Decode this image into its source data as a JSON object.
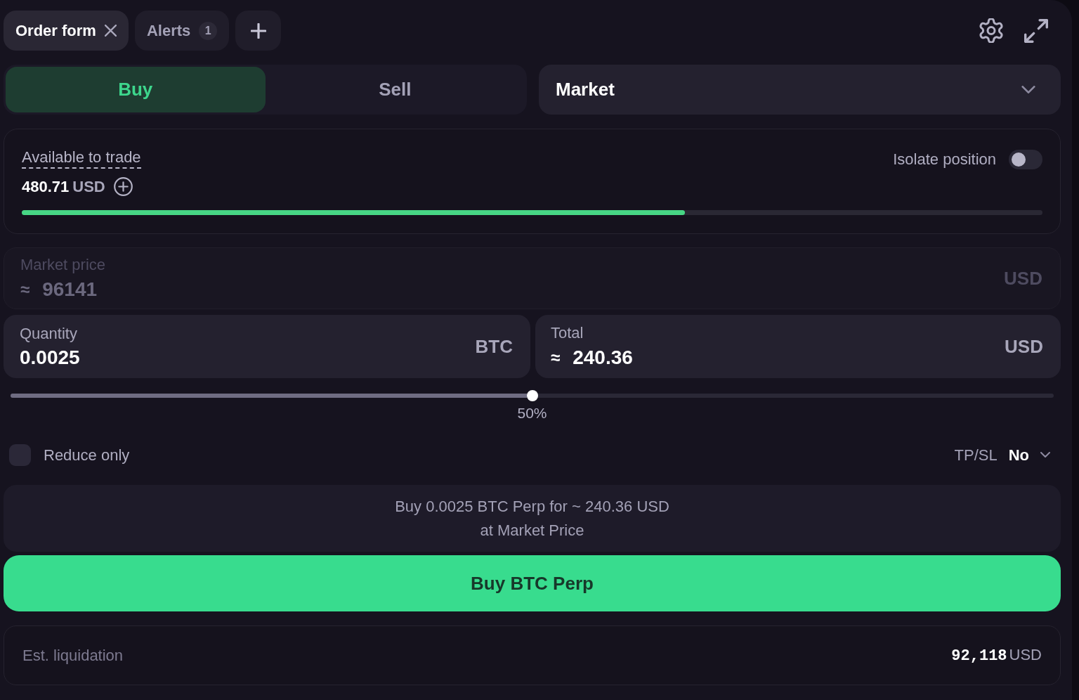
{
  "tabs": [
    {
      "label": "Order form",
      "selected": true,
      "closable": true
    },
    {
      "label": "Alerts",
      "badge": "1",
      "selected": false,
      "closable": false
    }
  ],
  "sides": [
    {
      "label": "Buy",
      "selected": true
    },
    {
      "label": "Sell",
      "selected": false
    }
  ],
  "order_type": {
    "value": "Market"
  },
  "available": {
    "label": "Available to trade",
    "amount": "480.71",
    "currency": "USD",
    "level": 0.65
  },
  "isolate": {
    "label": "Isolate position",
    "on": false
  },
  "market_price": {
    "label": "Market price",
    "prefix": "≈",
    "value": "96141",
    "unit": "USD",
    "disabled": true
  },
  "quantity": {
    "label": "Quantity",
    "value": "0.0025",
    "unit": "BTC",
    "disabled": false
  },
  "total": {
    "label": "Total",
    "prefix": "≈",
    "value": "240.36",
    "unit": "USD",
    "disabled": false
  },
  "slider": {
    "level": 0.5,
    "reading": "50%"
  },
  "reduce_only": {
    "label": "Reduce only",
    "checked": false
  },
  "tp_sl": {
    "label": "TP/SL",
    "value": "No"
  },
  "summary": {
    "lines": [
      "Buy 0.0025 BTC Perp for ~ 240.36 USD",
      "at Market Price"
    ]
  },
  "submit_button": {
    "label": "Buy BTC Perp"
  },
  "liquidation": {
    "label": "Est. liquidation",
    "value": "92,118",
    "currency": "USD"
  }
}
